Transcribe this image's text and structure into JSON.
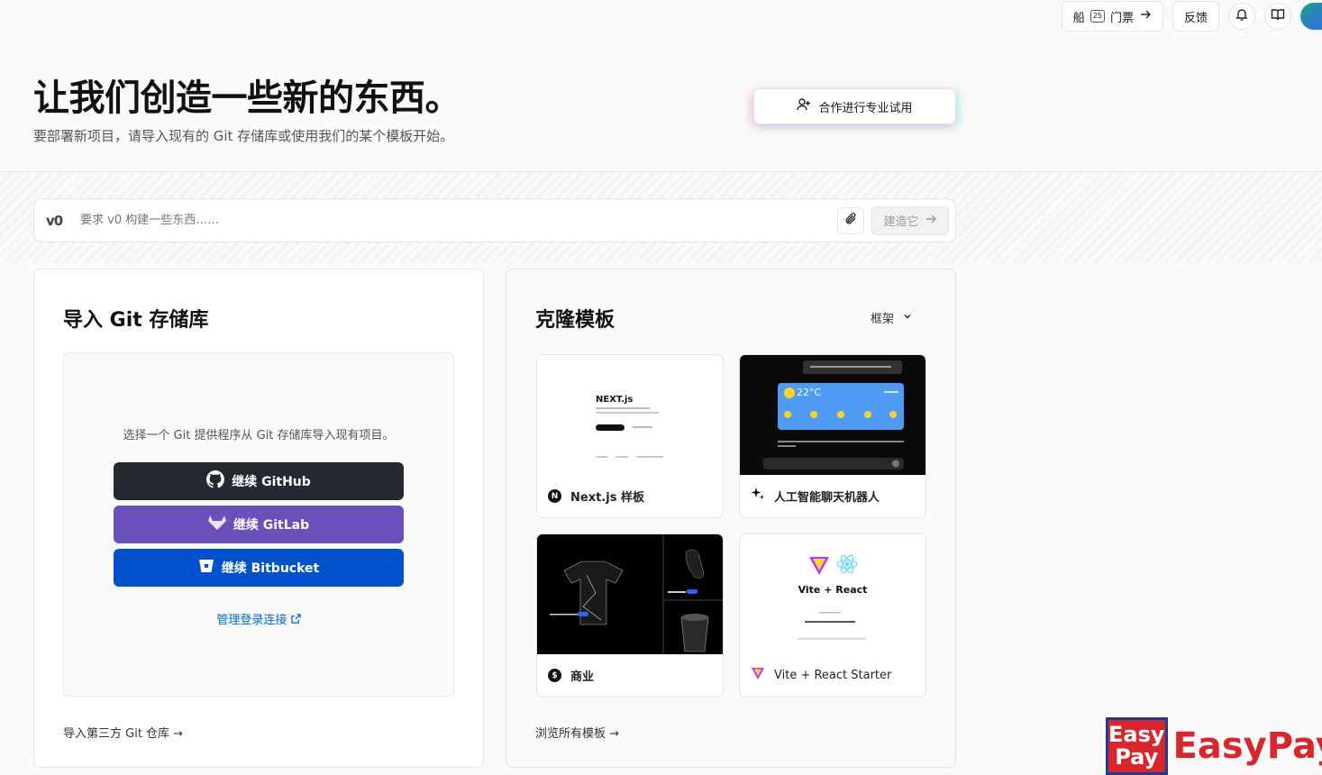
{
  "topbar": {
    "ship_label": "船",
    "ship_badge": "25",
    "tickets_label": "门票",
    "feedback_label": "反馈"
  },
  "hero": {
    "title": "让我们创造一些新的东西。",
    "subtitle": "要部署新项目，请导入现有的 Git 存储库或使用我们的某个模板开始。",
    "collab_label": "合作进行专业试用"
  },
  "prompt": {
    "logo": "v0",
    "placeholder": "要求 v0 构建一些东西……",
    "build_label": "建造它"
  },
  "import_card": {
    "title": "导入 Git 存储库",
    "hint": "选择一个 Git 提供程序从 Git 存储库导入现有项目。",
    "github_label": "继续 GitHub",
    "gitlab_label": "继续 GitLab",
    "bitbucket_label": "继续 Bitbucket",
    "manage_label": "管理登录连接",
    "third_party_label": "导入第三方 Git 仓库 →"
  },
  "clone_card": {
    "title": "克隆模板",
    "framework_label": "框架",
    "templates": [
      {
        "label": "Next.js 样板"
      },
      {
        "label": "人工智能聊天机器人",
        "temp": "22°C"
      },
      {
        "label": "商业"
      },
      {
        "label": "Vite + React Starter",
        "thumb_title": "Vite + React"
      }
    ],
    "browse_label": "浏览所有模板 →"
  },
  "watermark": {
    "box_line1": "Easy",
    "box_line2": "Pay",
    "text": "EasyPay"
  },
  "colors": {
    "github": "#24292f",
    "gitlab": "#6b4fbb",
    "bitbucket": "#0052cc",
    "link": "#0068d6"
  }
}
